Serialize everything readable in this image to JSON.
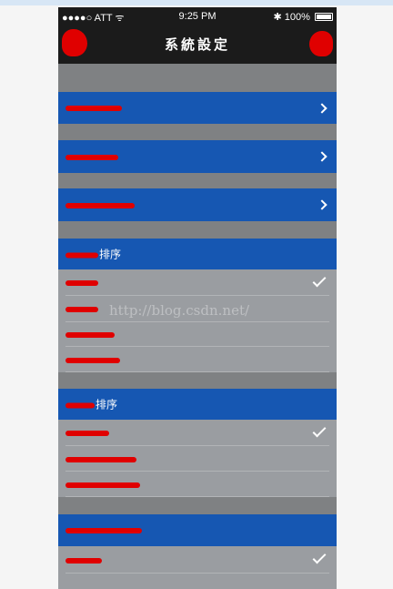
{
  "status_bar": {
    "carrier": "●●●●○ ATT",
    "wifi_glyph": "ᯤ",
    "time": "9:25 PM",
    "bluetooth_glyph": "✱",
    "battery": "100%"
  },
  "nav": {
    "title": "系統設定"
  },
  "menu": {
    "items": [
      {
        "label": "",
        "icon": "chevron-right-icon"
      },
      {
        "label": "",
        "icon": "chevron-right-icon"
      },
      {
        "label": "",
        "icon": "chevron-right-icon"
      }
    ]
  },
  "sections": [
    {
      "header": "排序",
      "options": [
        {
          "label": "",
          "checked": true
        },
        {
          "label": "",
          "checked": false
        },
        {
          "label": "",
          "checked": false
        },
        {
          "label": "",
          "checked": false
        }
      ]
    },
    {
      "header": "排序",
      "options": [
        {
          "label": "",
          "checked": true
        },
        {
          "label": "",
          "checked": false
        },
        {
          "label": "",
          "checked": false
        }
      ]
    },
    {
      "header": "",
      "options": [
        {
          "label": "",
          "checked": true
        },
        {
          "label": "",
          "checked": false
        }
      ]
    }
  ],
  "watermark": "http://blog.csdn.net/",
  "colors": {
    "nav_background": "#1b1b1b",
    "row_blue": "#1657b2",
    "option_gray": "#9a9da1",
    "gap_gray": "#7f8183",
    "redaction_red": "#e00000"
  }
}
